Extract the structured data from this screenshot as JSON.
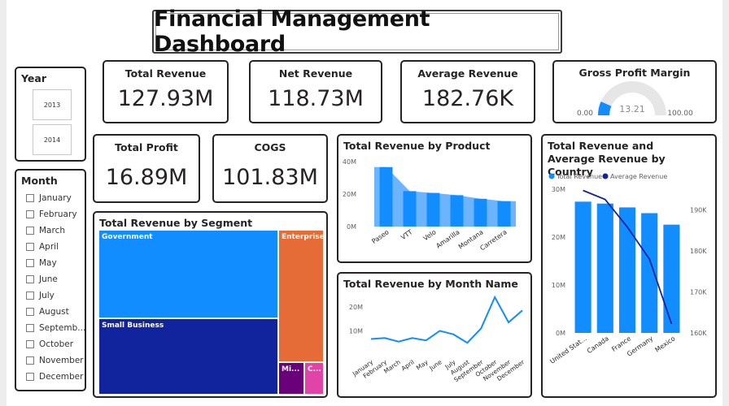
{
  "page_title": "Financial Management Dashboard",
  "kpis": {
    "total_revenue": {
      "label": "Total Revenue",
      "value": "127.93M"
    },
    "net_revenue": {
      "label": "Net Revenue",
      "value": "118.73M"
    },
    "average_revenue": {
      "label": "Average Revenue",
      "value": "182.76K"
    },
    "total_profit": {
      "label": "Total Profit",
      "value": "16.89M"
    },
    "cogs": {
      "label": "COGS",
      "value": "101.83M"
    }
  },
  "gauge": {
    "title": "Gross Profit Margin",
    "min_label": "0.00",
    "max_label": "100.00",
    "value_label": "13.21",
    "value": 13.21,
    "min": 0,
    "max": 100,
    "fill_color": "#118DFF",
    "track_color": "#E6E6E6"
  },
  "year_slicer": {
    "title": "Year",
    "options": [
      "2013",
      "2014"
    ]
  },
  "month_slicer": {
    "title": "Month",
    "options": [
      "January",
      "February",
      "March",
      "April",
      "May",
      "June",
      "July",
      "August",
      "Septemb...",
      "October",
      "November",
      "December"
    ]
  },
  "segment_treemap": {
    "title": "Total Revenue by Segment",
    "cells": [
      {
        "label": "Government",
        "color": "#118DFF"
      },
      {
        "label": "Small Business",
        "color": "#12239E"
      },
      {
        "label": "Enterprise",
        "color": "#E66C37"
      },
      {
        "label": "Mi...",
        "color": "#6B007B"
      },
      {
        "label": "C...",
        "color": "#E044A7"
      }
    ]
  },
  "chart_data": [
    {
      "type": "bar",
      "title": "Total Revenue by Product",
      "categories": [
        "Paseo",
        "VTT",
        "Velo",
        "Amarilla",
        "Montana",
        "Carretera"
      ],
      "values": [
        36.6,
        21.8,
        20.7,
        19.3,
        17.1,
        15.6
      ],
      "ylim": [
        0,
        40
      ],
      "yticks": [
        "0M",
        "20M",
        "40M"
      ],
      "color": "#118DFF",
      "area_color": "#6CB4FF"
    },
    {
      "type": "line",
      "title": "Total Revenue by Month Name",
      "categories": [
        "January",
        "February",
        "March",
        "April",
        "May",
        "June",
        "July",
        "August",
        "September",
        "October",
        "November",
        "December"
      ],
      "values": [
        6.6,
        7.0,
        5.5,
        7.0,
        6.0,
        10.0,
        8.5,
        5.0,
        11.0,
        24.0,
        13.5,
        18.5
      ],
      "ylim": [
        0,
        25
      ],
      "yticks": [
        "10M",
        "20M"
      ],
      "color": "#118DFF"
    },
    {
      "type": "bar",
      "title": "Total Revenue and Average Revenue by Country",
      "legend": [
        "Total Revenue",
        "Average Revenue"
      ],
      "categories": [
        "United Stat...",
        "Canada",
        "France",
        "Germany",
        "Mexico"
      ],
      "series": [
        {
          "name": "Total Revenue",
          "values": [
            27.4,
            27.0,
            26.2,
            25.0,
            22.6
          ],
          "color": "#118DFF"
        },
        {
          "name": "Average Revenue",
          "values": [
            194700,
            192500,
            185800,
            178000,
            162200
          ],
          "color": "#12239E"
        }
      ],
      "ylim_left": [
        0,
        30
      ],
      "yticks_left": [
        "0M",
        "10M",
        "20M",
        "30M"
      ],
      "ylim_right": [
        160000,
        195000
      ],
      "yticks_right": [
        "160K",
        "170K",
        "180K",
        "190K"
      ]
    }
  ]
}
